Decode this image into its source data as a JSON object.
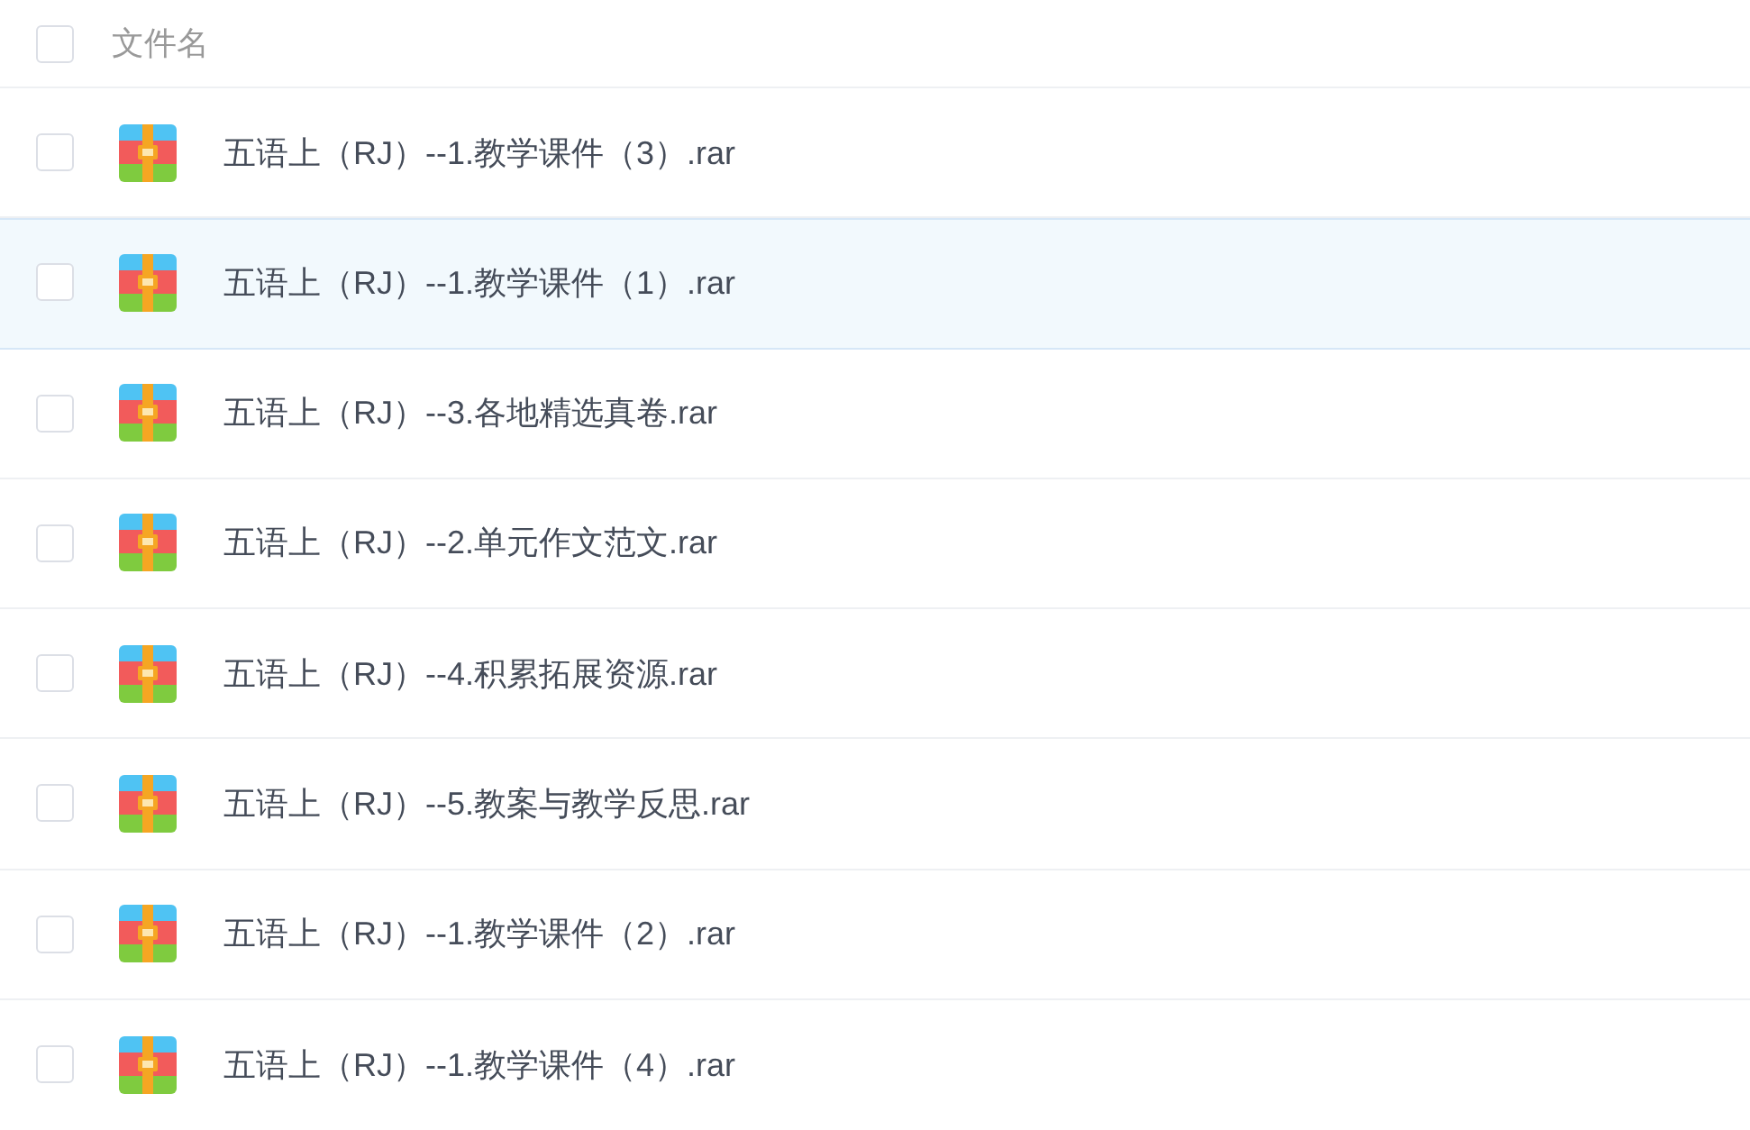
{
  "header": {
    "checked": false,
    "label": "文件名"
  },
  "files": [
    {
      "name": "五语上（RJ）--1.教学课件（3）.rar",
      "checked": false,
      "selected": false
    },
    {
      "name": "五语上（RJ）--1.教学课件（1）.rar",
      "checked": false,
      "selected": true
    },
    {
      "name": "五语上（RJ）--3.各地精选真卷.rar",
      "checked": false,
      "selected": false
    },
    {
      "name": "五语上（RJ）--2.单元作文范文.rar",
      "checked": false,
      "selected": false
    },
    {
      "name": "五语上（RJ）--4.积累拓展资源.rar",
      "checked": false,
      "selected": false
    },
    {
      "name": "五语上（RJ）--5.教案与教学反思.rar",
      "checked": false,
      "selected": false
    },
    {
      "name": "五语上（RJ）--1.教学课件（2）.rar",
      "checked": false,
      "selected": false
    },
    {
      "name": "五语上（RJ）--1.教学课件（4）.rar",
      "checked": false,
      "selected": false
    }
  ]
}
